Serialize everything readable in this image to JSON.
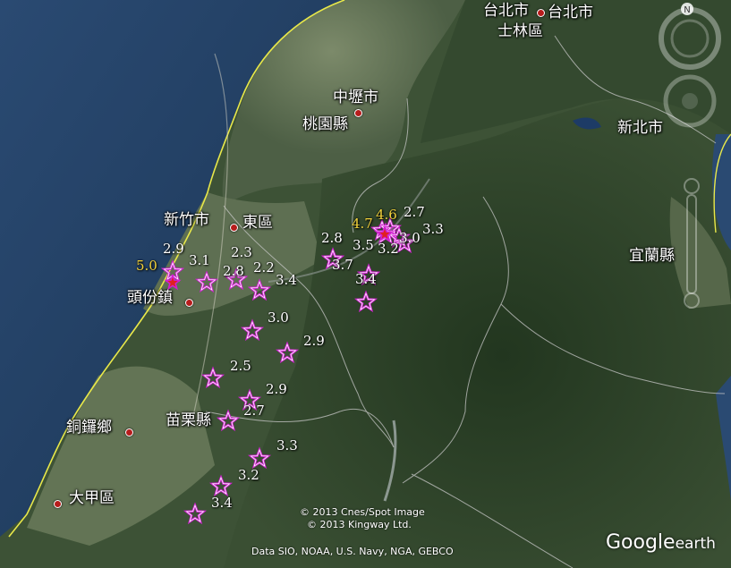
{
  "places": [
    {
      "id": "taipei-city-1",
      "label": "台北市",
      "dot": true,
      "dot_side": "right"
    },
    {
      "id": "taipei-city-2",
      "label": "台北市",
      "dot": true,
      "dot_side": "left"
    },
    {
      "id": "shilin-district",
      "label": "士林區",
      "dot": false
    },
    {
      "id": "zhongli-city",
      "label": "中壢市",
      "dot": true,
      "dot_side": "below-right"
    },
    {
      "id": "taoyuan-county",
      "label": "桃園縣",
      "dot": false
    },
    {
      "id": "new-taipei-city",
      "label": "新北市",
      "dot": false
    },
    {
      "id": "hsinchu-city",
      "label": "新竹市",
      "dot": false
    },
    {
      "id": "east-district",
      "label": "東區",
      "dot": true,
      "dot_side": "left"
    },
    {
      "id": "toufen-township",
      "label": "頭份鎮",
      "dot": true,
      "dot_side": "right"
    },
    {
      "id": "yilan-county",
      "label": "宜蘭縣",
      "dot": false
    },
    {
      "id": "miaoli-county",
      "label": "苗栗縣",
      "dot": false
    },
    {
      "id": "tongluo-township",
      "label": "銅鑼鄉",
      "dot": true,
      "dot_side": "right"
    },
    {
      "id": "dajia-district",
      "label": "大甲區",
      "dot": true,
      "dot_side": "left"
    }
  ],
  "earthquakes": [
    {
      "mag": "5.0",
      "color": "#f2d23c"
    },
    {
      "mag": "2.9",
      "color": "#ffffff"
    },
    {
      "mag": "3.1",
      "color": "#ffffff"
    },
    {
      "mag": "2.3",
      "color": "#ffffff"
    },
    {
      "mag": "2.8",
      "color": "#ffffff"
    },
    {
      "mag": "2.2",
      "color": "#ffffff"
    },
    {
      "mag": "3.4",
      "color": "#ffffff"
    },
    {
      "mag": "3.0",
      "color": "#ffffff"
    },
    {
      "mag": "2.9",
      "color": "#ffffff"
    },
    {
      "mag": "2.5",
      "color": "#ffffff"
    },
    {
      "mag": "2.9",
      "color": "#ffffff"
    },
    {
      "mag": "2.7",
      "color": "#ffffff"
    },
    {
      "mag": "3.3",
      "color": "#ffffff"
    },
    {
      "mag": "3.2",
      "color": "#ffffff"
    },
    {
      "mag": "3.4",
      "color": "#ffffff"
    },
    {
      "mag": "4.7",
      "color": "#f2d23c"
    },
    {
      "mag": "4.6",
      "color": "#f2d23c"
    },
    {
      "mag": "2.7",
      "color": "#ffffff"
    },
    {
      "mag": "3.3",
      "color": "#ffffff"
    },
    {
      "mag": "3.0",
      "color": "#ffffff"
    },
    {
      "mag": "3.2",
      "color": "#ffffff"
    },
    {
      "mag": "2.8",
      "color": "#ffffff"
    },
    {
      "mag": "3.5",
      "color": "#ffffff"
    },
    {
      "mag": "3.7",
      "color": "#ffffff"
    },
    {
      "mag": "3.4",
      "color": "#ffffff"
    }
  ],
  "credits": {
    "imagery_1": "© 2013 Cnes/Spot Image",
    "imagery_2": "© 2013 Kingway Ltd.",
    "data": "Data SIO, NOAA, U.S. Navy, NGA, GEBCO"
  },
  "logo": {
    "main": "Google",
    "suffix": "earth"
  },
  "nav": {
    "north": "N"
  },
  "colors": {
    "sea": "#1f3a5c",
    "coastline": "#e8e84a",
    "star_stroke": "#d21fd2",
    "major_quake_label": "#f2d23c"
  }
}
